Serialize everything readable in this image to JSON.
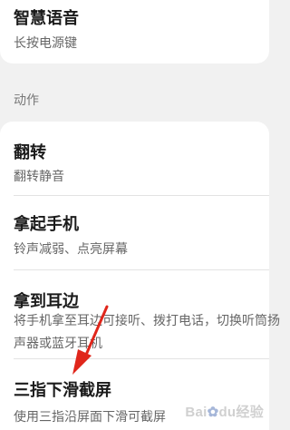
{
  "top_item": {
    "title": "智慧语音",
    "subtitle": "长按电源键"
  },
  "section": {
    "header": "动作"
  },
  "items": [
    {
      "title": "翻转",
      "subtitle": "翻转静音"
    },
    {
      "title": "拿起手机",
      "subtitle": "铃声减弱、点亮屏幕"
    },
    {
      "title": "拿到耳边",
      "subtitle": "将手机拿至耳边可接听、拨打电话，切换听筒扬声器或蓝牙耳机"
    },
    {
      "title": "三指下滑截屏",
      "subtitle": "使用三指沿屏面下滑可截屏"
    }
  ],
  "annotation": {
    "arrow_color": "#e0261b",
    "icon": "red-arrow-icon"
  },
  "watermark": {
    "text": "Bai",
    "text2": "du",
    "suffix": "经验"
  }
}
